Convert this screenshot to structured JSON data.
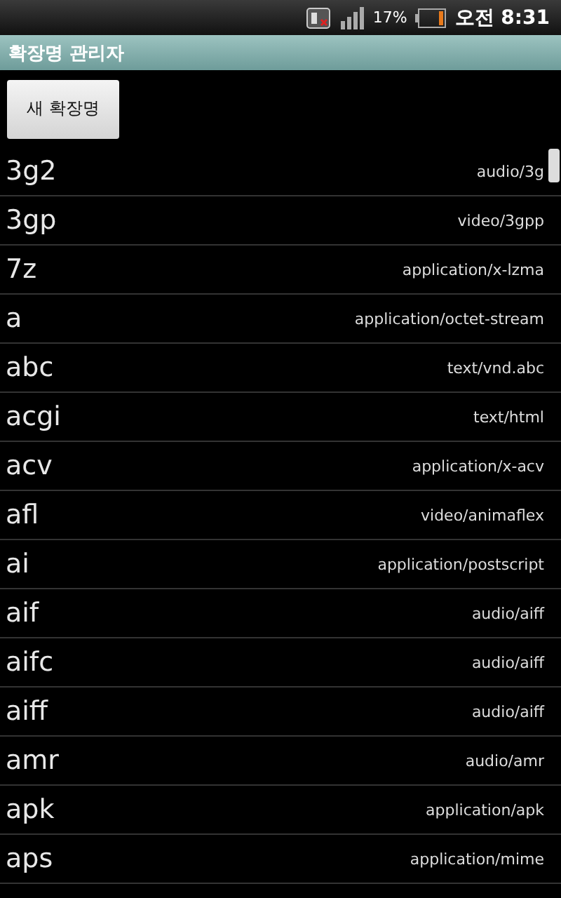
{
  "status_bar": {
    "battery_percent": "17%",
    "time": "오전 8:31"
  },
  "title_bar": {
    "title": "확장명 관리자"
  },
  "new_button": {
    "label": "새 확장명"
  },
  "rows": [
    {
      "extension": "3g2",
      "mime": "audio/3g"
    },
    {
      "extension": "3gp",
      "mime": "video/3gpp"
    },
    {
      "extension": "7z",
      "mime": "application/x-lzma"
    },
    {
      "extension": "a",
      "mime": "application/octet-stream"
    },
    {
      "extension": "abc",
      "mime": "text/vnd.abc"
    },
    {
      "extension": "acgi",
      "mime": "text/html"
    },
    {
      "extension": "acv",
      "mime": "application/x-acv"
    },
    {
      "extension": "afl",
      "mime": "video/animaflex"
    },
    {
      "extension": "ai",
      "mime": "application/postscript"
    },
    {
      "extension": "aif",
      "mime": "audio/aiff"
    },
    {
      "extension": "aifc",
      "mime": "audio/aiff"
    },
    {
      "extension": "aiff",
      "mime": "audio/aiff"
    },
    {
      "extension": "amr",
      "mime": "audio/amr"
    },
    {
      "extension": "apk",
      "mime": "application/apk"
    },
    {
      "extension": "aps",
      "mime": "application/mime"
    }
  ]
}
